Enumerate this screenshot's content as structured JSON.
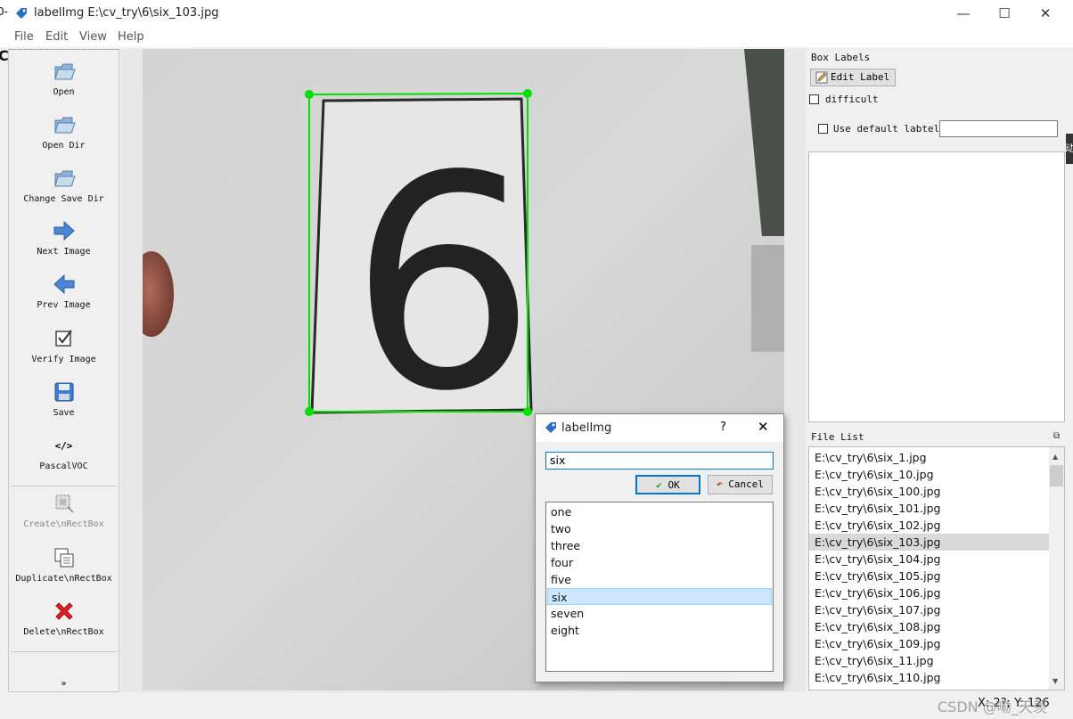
{
  "window": {
    "title": "labelImg E:\\cv_try\\6\\six_103.jpg"
  },
  "menu": [
    "File",
    "Edit",
    "View",
    "Help"
  ],
  "toolbar": [
    {
      "label": "Open",
      "icon": "folder-icon"
    },
    {
      "label": "Open Dir",
      "icon": "folder-icon"
    },
    {
      "label": "Change Save Dir",
      "icon": "folder-icon"
    },
    {
      "label": "Next Image",
      "icon": "arrow-right-icon"
    },
    {
      "label": "Prev Image",
      "icon": "arrow-left-icon"
    },
    {
      "label": "Verify Image",
      "icon": "checkbox-icon"
    },
    {
      "label": "Save",
      "icon": "floppy-disk-icon"
    },
    {
      "label": "PascalVOC",
      "icon": "code-icon"
    },
    {
      "label": "Create\\nRectBox",
      "icon": "create-rect-icon",
      "disabled": true
    },
    {
      "label": "Duplicate\\nRectBox",
      "icon": "duplicate-icon"
    },
    {
      "label": "Delete\\nRectBox",
      "icon": "delete-x-icon"
    }
  ],
  "canvas": {
    "digit": "6",
    "box_color": "#00e000"
  },
  "box_labels": {
    "title": "Box Labels",
    "edit_label": "Edit Label",
    "difficult": "difficult",
    "use_default": "Use default labtel"
  },
  "file_list": {
    "title": "File List",
    "files": [
      "E:\\cv_try\\6\\six_1.jpg",
      "E:\\cv_try\\6\\six_10.jpg",
      "E:\\cv_try\\6\\six_100.jpg",
      "E:\\cv_try\\6\\six_101.jpg",
      "E:\\cv_try\\6\\six_102.jpg",
      "E:\\cv_try\\6\\six_103.jpg",
      "E:\\cv_try\\6\\six_104.jpg",
      "E:\\cv_try\\6\\six_105.jpg",
      "E:\\cv_try\\6\\six_106.jpg",
      "E:\\cv_try\\6\\six_107.jpg",
      "E:\\cv_try\\6\\six_108.jpg",
      "E:\\cv_try\\6\\six_109.jpg",
      "E:\\cv_try\\6\\six_11.jpg",
      "E:\\cv_try\\6\\six_110.jpg"
    ],
    "selected_file": "E:\\cv_try\\6\\six_103.jpg"
  },
  "dialog": {
    "title": "labelImg",
    "help": "?",
    "input_value": "six",
    "ok": "OK",
    "cancel": "Cancel",
    "labels": [
      "one",
      "two",
      "three",
      "four",
      "five",
      "six",
      "seven",
      "eight"
    ],
    "selected_label": "six"
  },
  "status": {
    "coords": "X: 2?; Y: 126",
    "watermark": "CSDN @嘞_天羡"
  },
  "bleed": {
    "top_left": "0-",
    "mid_left": "C",
    "right_edge": "动"
  }
}
